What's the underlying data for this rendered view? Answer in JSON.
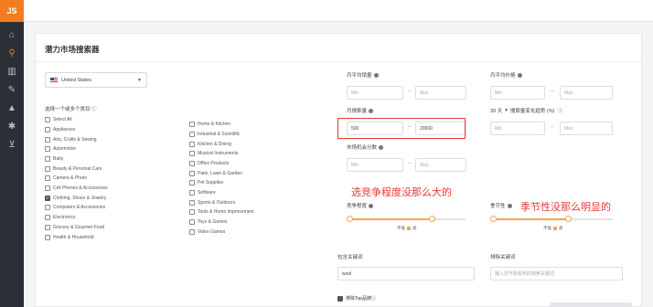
{
  "app": {
    "logo": "JS"
  },
  "panel": {
    "title": "潜力市场搜索器"
  },
  "market": {
    "selected": "United States"
  },
  "categories": {
    "label": "选择一个或多个类目",
    "col1": [
      {
        "label": "Select All",
        "checked": false
      },
      {
        "label": "Appliances",
        "checked": false
      },
      {
        "label": "Arts, Crafts & Sewing",
        "checked": false
      },
      {
        "label": "Automotive",
        "checked": false
      },
      {
        "label": "Baby",
        "checked": false
      },
      {
        "label": "Beauty & Personal Care",
        "checked": false
      },
      {
        "label": "Camera & Photo",
        "checked": false
      },
      {
        "label": "Cell Phones & Accessories",
        "checked": false
      },
      {
        "label": "Clothing, Shoes & Jewelry",
        "checked": true
      },
      {
        "label": "Computers & Accessories",
        "checked": false
      },
      {
        "label": "Electronics",
        "checked": false
      },
      {
        "label": "Grocery & Gourmet Food",
        "checked": false
      },
      {
        "label": "Health & Household",
        "checked": false
      }
    ],
    "col2": [
      {
        "label": "Home & Kitchen",
        "checked": false
      },
      {
        "label": "Industrial & Scientific",
        "checked": false
      },
      {
        "label": "Kitchen & Dining",
        "checked": false
      },
      {
        "label": "Musical Instruments",
        "checked": false
      },
      {
        "label": "Office Products",
        "checked": false
      },
      {
        "label": "Patio, Lawn & Garden",
        "checked": false
      },
      {
        "label": "Pet Supplies",
        "checked": false
      },
      {
        "label": "Software",
        "checked": false
      },
      {
        "label": "Sports & Outdoors",
        "checked": false
      },
      {
        "label": "Tools & Home Improvement",
        "checked": false
      },
      {
        "label": "Toys & Games",
        "checked": false
      },
      {
        "label": "Video Games",
        "checked": false
      }
    ]
  },
  "filters": {
    "unit_sales": {
      "label": "月平均销量",
      "min_ph": "Min",
      "max_ph": "Max"
    },
    "avg_price": {
      "label": "月平均价格",
      "min_ph": "Min",
      "max_ph": "Max"
    },
    "search_volume": {
      "label": "月搜索量",
      "min_val": "500",
      "max_val": "20000"
    },
    "growth": {
      "period": "30 天",
      "label": "搜索量变化趋势 (%)",
      "min_ph": "Min",
      "max_ph": "Max"
    },
    "niche_score": {
      "label": "市场机会分数",
      "min_ph": "Min",
      "max_ph": "Max"
    },
    "competition": {
      "label": "竞争程度",
      "caption_left": "不低",
      "caption_right": "高"
    },
    "seasonality": {
      "label": "季节性",
      "caption_left": "不低",
      "caption_right": "高"
    },
    "include_keywords": {
      "label": "包含关键词",
      "value": "wool"
    },
    "exclude_keywords": {
      "label": "排除关键词",
      "placeholder": "输入您不想看到的搜索关键词"
    }
  },
  "annotations": {
    "competition": "选竞争程度没那么大的",
    "seasonality": "季节性没那么明显的"
  },
  "bottom": {
    "checkbox_label": "排除Top品牌"
  },
  "colors": {
    "accent": "#f47b20",
    "annotation": "#e53935",
    "slider": "#f4a64a"
  }
}
